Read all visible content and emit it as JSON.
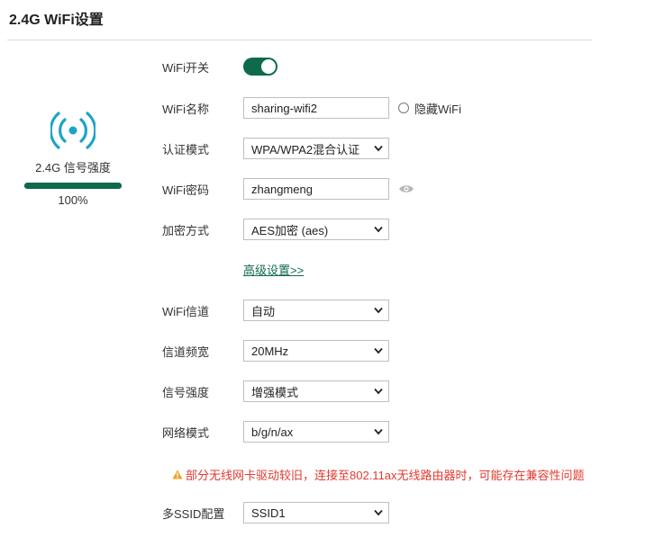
{
  "page": {
    "title": "2.4G WiFi设置"
  },
  "signal": {
    "label": "2.4G 信号强度",
    "percent_text": "100%",
    "level": 1.0
  },
  "form": {
    "wifi_switch": {
      "label": "WiFi开关",
      "on": true
    },
    "ssid": {
      "label": "WiFi名称",
      "value": "sharing-wifi2",
      "hide_label": "隐藏WiFi"
    },
    "auth": {
      "label": "认证模式",
      "value": "WPA/WPA2混合认证"
    },
    "password": {
      "label": "WiFi密码",
      "value": "zhangmeng"
    },
    "encryption": {
      "label": "加密方式",
      "value": "AES加密 (aes)"
    },
    "advanced_link": "高级设置>>",
    "channel": {
      "label": "WiFi信道",
      "value": "自动"
    },
    "bandwidth": {
      "label": "信道频宽",
      "value": "20MHz"
    },
    "strength": {
      "label": "信号强度",
      "value": "增强模式"
    },
    "mode": {
      "label": "网络模式",
      "value": "b/g/n/ax"
    },
    "warning": "部分无线网卡驱动较旧，连接至802.11ax无线路由器时，可能存在兼容性问题",
    "multi_ssid": {
      "label": "多SSID配置",
      "value": "SSID1"
    }
  },
  "colors": {
    "accent": "#0f6a4c",
    "warning": "#e03a2f",
    "icon": "#1fa3c8"
  },
  "icons": [
    "wifi-signal-icon",
    "eye-icon",
    "warning-icon",
    "chevron-down-icon"
  ]
}
